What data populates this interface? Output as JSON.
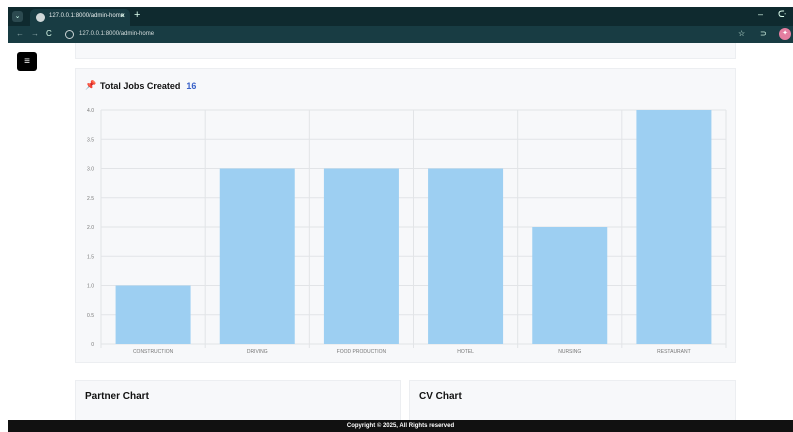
{
  "browser": {
    "tab_title": "127.0.0.1:8000/admin-home",
    "tab_close": "×",
    "new_tab": "+",
    "url": "127.0.0.1:8000/admin-home",
    "back": "←",
    "forward": "→",
    "reload": "C",
    "star": "☆",
    "extensions": "⊃",
    "minimize": "–",
    "restore": "ᑢ"
  },
  "sidebar_toggle": {
    "icon": "≡"
  },
  "jobs_card": {
    "title": "Total Jobs Created",
    "count": "16"
  },
  "chart_data": {
    "type": "bar",
    "categories": [
      "CONSTRUCTION",
      "DRIVING",
      "FOOD PRODUCTION",
      "HOTEL",
      "NURSING",
      "RESTAURANT"
    ],
    "values": [
      1,
      3,
      3,
      3,
      2,
      4
    ],
    "ylim": [
      0,
      4
    ],
    "yticks": [
      "0",
      "0.5",
      "1.0",
      "1.5",
      "2.0",
      "2.5",
      "3.0",
      "3.5",
      "4.0"
    ],
    "grid": true,
    "bar_color": "#9dcff2"
  },
  "partner_card": {
    "title": "Partner Chart"
  },
  "cv_card": {
    "title": "CV Chart"
  },
  "footer": {
    "text": "Copyright © 2025, All Rights reserved"
  }
}
